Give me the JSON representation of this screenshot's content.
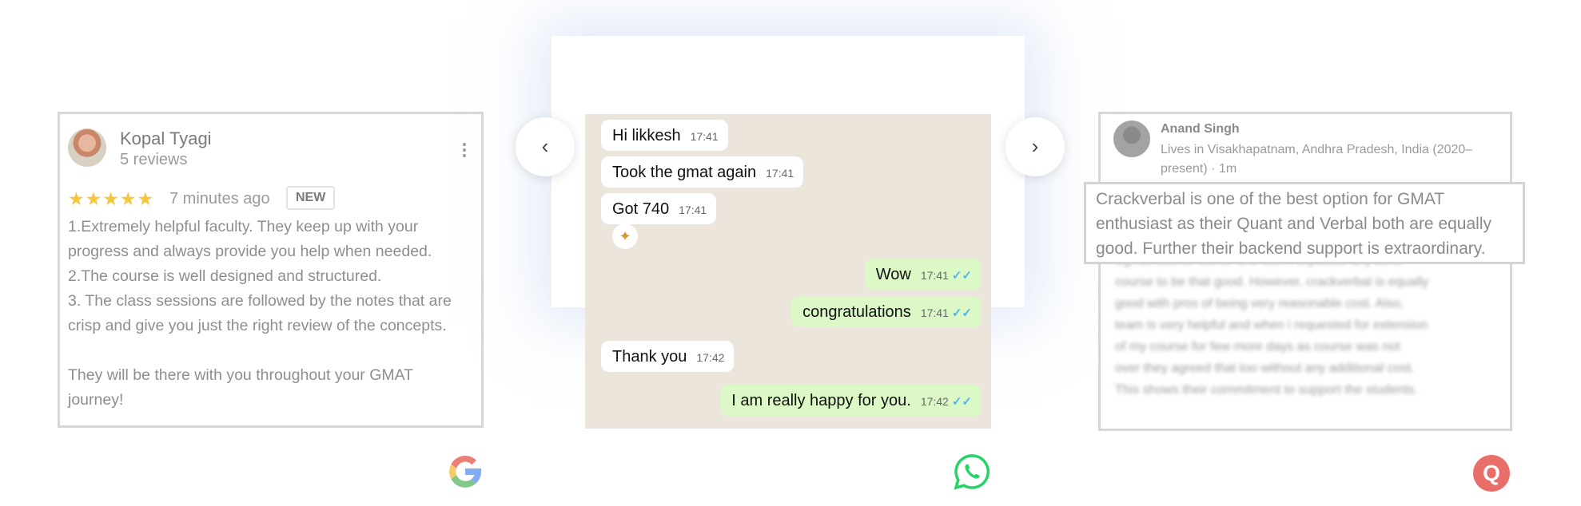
{
  "google_review": {
    "name": "Kopal Tyagi",
    "reviews": "5 reviews",
    "stars": "★★★★★",
    "rating": 5,
    "time": "7 minutes ago",
    "badge": "NEW",
    "body": [
      "1.Extremely helpful faculty. They keep up with your",
      "progress and always provide you help when needed.",
      "2.The course is well designed and structured.",
      "3. The class sessions are followed by the notes that are",
      "crisp and give you just the right review of the concepts.",
      "",
      "They will be there with you throughout your GMAT",
      "journey!"
    ]
  },
  "nav": {
    "prev_icon": "‹",
    "next_icon": "›"
  },
  "whatsapp": {
    "messages": [
      {
        "text": "Hi likkesh",
        "time": "17:41",
        "dir": "in"
      },
      {
        "text": "Took the gmat again",
        "time": "17:41",
        "dir": "in"
      },
      {
        "text": "Got 740",
        "time": "17:41",
        "dir": "in"
      },
      {
        "text": "Wow",
        "time": "17:41",
        "dir": "out",
        "ticks": "✓✓"
      },
      {
        "text": "congratulations",
        "time": "17:41",
        "dir": "out",
        "ticks": "✓✓"
      },
      {
        "text": "Thank you",
        "time": "17:42",
        "dir": "in"
      },
      {
        "text": "I am really happy for you.",
        "time": "17:42",
        "dir": "out",
        "ticks": "✓✓"
      }
    ],
    "reaction_icon": "clapping-hands-icon"
  },
  "quora_review": {
    "name": "Anand Singh",
    "meta_line1": "Lives in Visakhapatnam, Andhra Pradesh, India (2020–",
    "meta_line2": "present) · 1m",
    "highlight": [
      "Crackverbal is one of the best option for GMAT",
      "enthusiast as their Quant and Verbal both are equally",
      "good. Further their backend support is extraordinary."
    ],
    "blurred": [
      "Egmat course earlier and didn't expected any other",
      "course to be that good. However, crackverbal is equally",
      "good with pros of being very reasonable cost. Also,",
      "team is very helpful and when i requested for extension",
      "of my course for few more days as course was not",
      "over they agreed that too without any additional cost.",
      "This shows their commitment to support the students."
    ]
  },
  "logos": {
    "google": "G",
    "whatsapp": "whatsapp-icon",
    "quora": "Q"
  },
  "colors": {
    "star": "#f4c73d",
    "whatsapp_green": "#25d366",
    "quora_red": "#e86e6a",
    "chat_bg": "#ebe5dc",
    "out_bubble": "#dcf8c6"
  }
}
